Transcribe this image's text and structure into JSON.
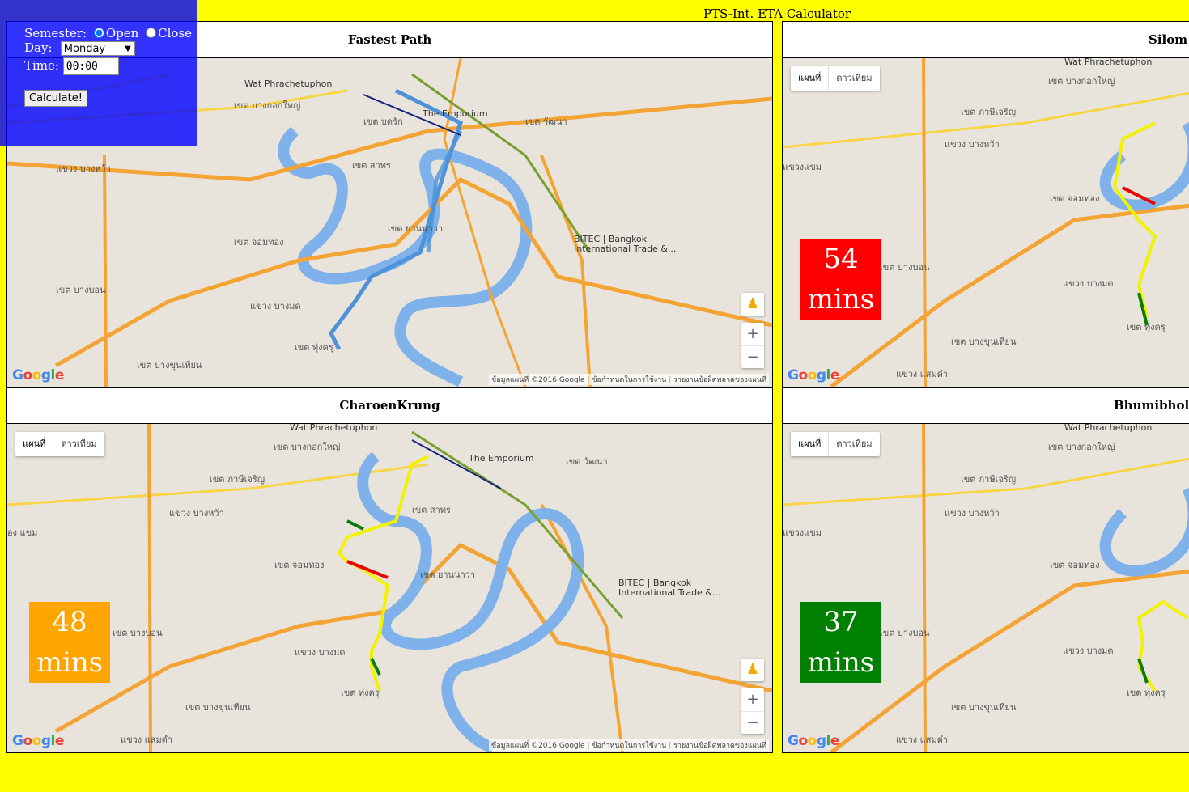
{
  "app": {
    "title": "PTS-Int. ETA Calculator"
  },
  "controls": {
    "semester_label": "Semester:",
    "semester_options": [
      "Open",
      "Close"
    ],
    "semester_selected": "Open",
    "day_label": "Day:",
    "day_value": "Monday",
    "time_label": "Time:",
    "time_value": "00:00",
    "calculate_label": "Calculate!"
  },
  "map_ui": {
    "map_type_options": [
      "แผนที่",
      "ดาวเทียม"
    ],
    "logo": "Google",
    "zoom_in": "+",
    "zoom_out": "−",
    "attribution": [
      "ข้อมูลแผนที่ ©2016 Google",
      "ข้อกำหนดในการใช้งาน",
      "รายงานข้อผิดพลาดของแผนที่"
    ],
    "labels": {
      "wat": "Wat Phrachetuphon",
      "emporium": "The Emporium",
      "bitec": "BITEC | Bangkok International Trade &...",
      "district1": "เขต บางกอกใหญ่",
      "district2": "เขต จอมทอง",
      "district3": "เขต ยานนาวา",
      "district4": "เขต บางขุนเทียน",
      "district5": "เขต ทุ่งครุ",
      "district6": "เขต วัฒนา",
      "district7": "เขต สาทร",
      "district8": "เขต บางบอน",
      "district9": "แขวง บางหว้า",
      "district10": "แขวง บางมด"
    }
  },
  "panels": {
    "fastest": {
      "title": "Fastest Path"
    },
    "silom": {
      "title": "Silom",
      "eta": "54",
      "unit": "mins",
      "color": "#ff0000"
    },
    "charoenkrung": {
      "title": "CharoenKrung",
      "eta": "48",
      "unit": "mins",
      "color": "#ffa500"
    },
    "bhumibhol": {
      "title": "Bhumibhol Br",
      "eta": "37",
      "unit": "mins",
      "color": "#008000"
    }
  }
}
